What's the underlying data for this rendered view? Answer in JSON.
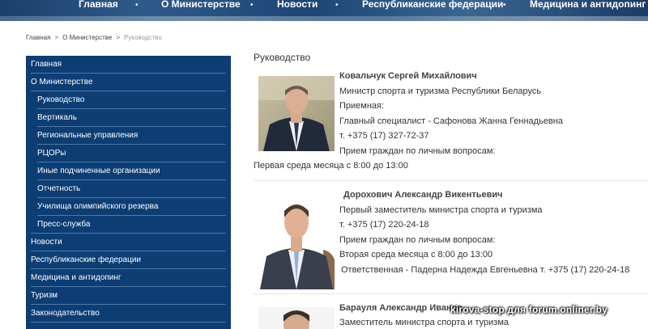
{
  "topnav": {
    "items": [
      "Главная",
      "О Министерстве",
      "Новости",
      "Республиканские федерации",
      "Медицина и антидопинг"
    ]
  },
  "breadcrumb": {
    "items": [
      "Главная",
      "О Министерстве",
      "Руководство"
    ],
    "separator": ">"
  },
  "sidebar": {
    "items": [
      {
        "label": "Главная",
        "level": "top"
      },
      {
        "label": "О Министерстве",
        "level": "top"
      },
      {
        "label": "Руководство",
        "level": "sub"
      },
      {
        "label": "Вертикаль",
        "level": "sub"
      },
      {
        "label": "Региональные управления",
        "level": "sub"
      },
      {
        "label": "РЦОРы",
        "level": "sub"
      },
      {
        "label": "Иные подчиненные организации",
        "level": "sub"
      },
      {
        "label": "Отчетность",
        "level": "sub"
      },
      {
        "label": "Училища олимпийского резерва",
        "level": "sub"
      },
      {
        "label": "Пресс-служба",
        "level": "sub"
      },
      {
        "label": "Новости",
        "level": "top"
      },
      {
        "label": "Республиканские федерации",
        "level": "top"
      },
      {
        "label": "Медицина и антидопинг",
        "level": "top"
      },
      {
        "label": "Туризм",
        "level": "top"
      },
      {
        "label": "Законодательство",
        "level": "top"
      }
    ]
  },
  "main": {
    "title": "Руководство",
    "persons": [
      {
        "name": "Ковальчук Сергей Михайлович",
        "lines": [
          "Министр спорта и туризма Республики Беларусь",
          "Приемная:",
          "Главный специалист - Сафонова Жанна Геннадьевна",
          "т. +375 (17) 327-72-37",
          "Прием граждан по личным вопросам:",
          "Первая среда месяца с 8:00 до 13:00"
        ]
      },
      {
        "name": "Дорохович Александр Викентьевич",
        "lines": [
          "Первый заместитель министра спорта и туризма",
          "т. +375 (17) 220-24-18",
          "Прием граждан по личным вопросам:",
          "Вторая среда месяца с 8:00 до 13:00",
          "Ответственная - Падерна Надежда Евгеньевна т. +375 (17) 220-24-18"
        ]
      },
      {
        "name": "Барауля Александр Иванов",
        "lines": [
          "Заместитель министра спорта и туризма"
        ]
      }
    ]
  },
  "watermark": "kirova-stop для forum.onliner.by",
  "colors": {
    "sidebar_bg": "#0c3d73",
    "topnav_bg": "#1d4575"
  }
}
